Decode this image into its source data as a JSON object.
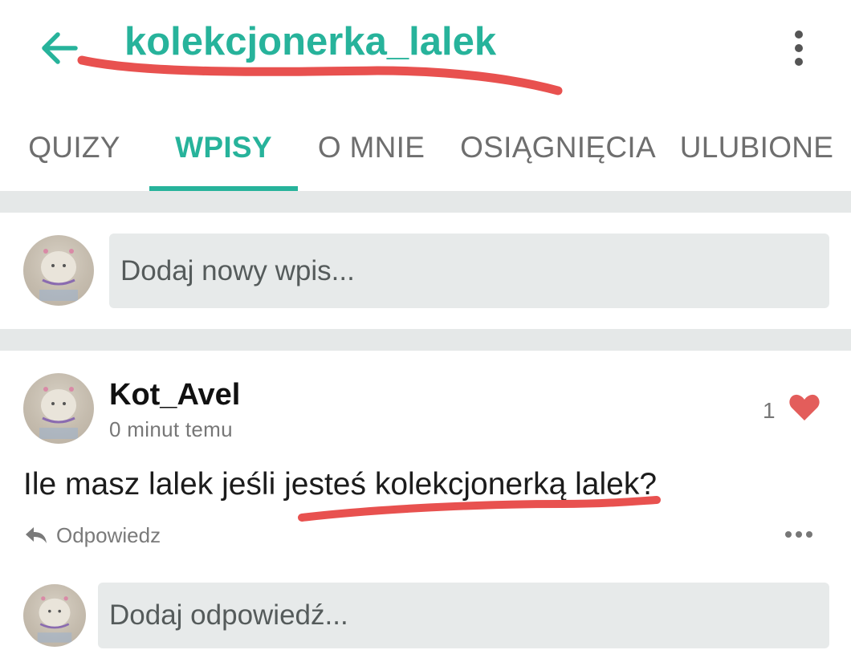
{
  "header": {
    "title": "kolekcjonerka_lalek",
    "back_icon": "arrow-left-icon",
    "menu_icon": "more-vertical-icon",
    "accent_color": "#27b39b"
  },
  "tabs": [
    {
      "label": "QUIZY",
      "active": false
    },
    {
      "label": "WPISY",
      "active": true
    },
    {
      "label": "O MNIE",
      "active": false
    },
    {
      "label": "OSIĄGNIĘCIA",
      "active": false
    },
    {
      "label": "ULUBIONE",
      "active": false
    }
  ],
  "composer": {
    "placeholder": "Dodaj nowy wpis..."
  },
  "post": {
    "author": "Kot_Avel",
    "time": "0 minut temu",
    "likes": "1",
    "like_icon": "heart-icon",
    "text_before": "Ile masz lalek jeśli ",
    "text_highlight": "jesteś kolekcjonerką lalek",
    "text_after": "?",
    "reply_label": "Odpowiedz",
    "reply_icon": "reply-arrow-icon",
    "more_icon": "more-horizontal-icon"
  },
  "reply_composer": {
    "placeholder": "Dodaj odpowiedź..."
  },
  "annotation_color": "#e8514f"
}
